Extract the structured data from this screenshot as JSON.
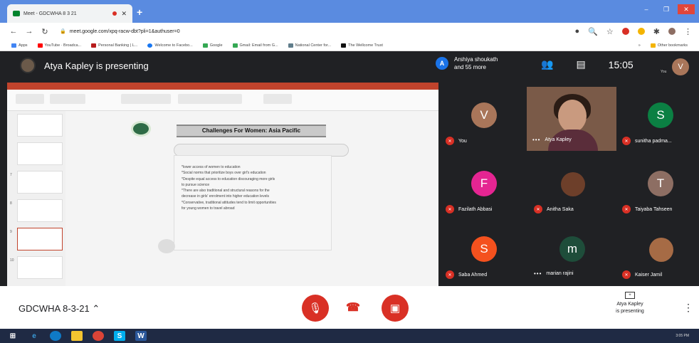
{
  "browser": {
    "tab_title": "Meet - GDCWHA 8 3 21",
    "new_tab": "+",
    "url": "meet.google.com/xpq-racw-dbt?pli=1&authuser=0",
    "window_controls": [
      "–",
      "❐",
      "✕"
    ]
  },
  "bookmarks": {
    "items": [
      "Apps",
      "YouTube · Broadca...",
      "Personal Banking | L...",
      "Welcome to Facebo...",
      "Google",
      "Gmail: Email from G...",
      "National Center for...",
      "The Wellcome Trust"
    ],
    "other": "Other bookmarks"
  },
  "meet": {
    "presenting_text": "Atya Kapley is presenting",
    "people_summary_initial": "A",
    "people_summary": [
      "Arshiya shoukath",
      "and 55 more"
    ],
    "clock": "15:05",
    "you_initial": "V",
    "you_label": "You"
  },
  "slide": {
    "heading": "Challenges For Women: Asia Pacific",
    "bullets": [
      "*lower access of women to education",
      "*Social norms that prioritize boys over girl's education",
      "*Despite equal access to education discouraging more girls",
      "to pursue science",
      "*There are also traditional and structural reasons for the",
      "decrease in girls' enrolment into higher education levels",
      "*Conservative, traditional attitudes tend to limit opportunities",
      "for young women to travel abroad"
    ],
    "thumb_numbers": [
      "",
      "",
      "7",
      "8",
      "9",
      "10"
    ]
  },
  "participants": [
    {
      "initial": "V",
      "name": "You",
      "color": "#a9765a"
    },
    {
      "initial": "",
      "name": "Atya Kapley",
      "color": ""
    },
    {
      "initial": "S",
      "name": "sunitha padma...",
      "color": "#0b8043"
    },
    {
      "initial": "F",
      "name": "Fazilath Abbasi",
      "color": "#e52592"
    },
    {
      "initial": "",
      "name": "Anitha Saka",
      "color": ""
    },
    {
      "initial": "T",
      "name": "Taiyaba Tahseen",
      "color": "#8d6e63"
    },
    {
      "initial": "S",
      "name": "Saba Ahmed",
      "color": "#f4511e"
    },
    {
      "initial": "m",
      "name": "marian rajini",
      "color": "#1e4d3a"
    },
    {
      "initial": "",
      "name": "Kaiser Jamil",
      "color": ""
    }
  ],
  "controls": {
    "meeting_code": "GDCWHA 8-3-21",
    "presenting_line1": "Atya Kapley",
    "presenting_line2": "is presenting"
  },
  "taskbar": {
    "time": "3:05 PM"
  },
  "colors": {
    "meet_bg": "#202124",
    "mute_red": "#d93025",
    "browser_tabstrip": "#5a8be0"
  }
}
